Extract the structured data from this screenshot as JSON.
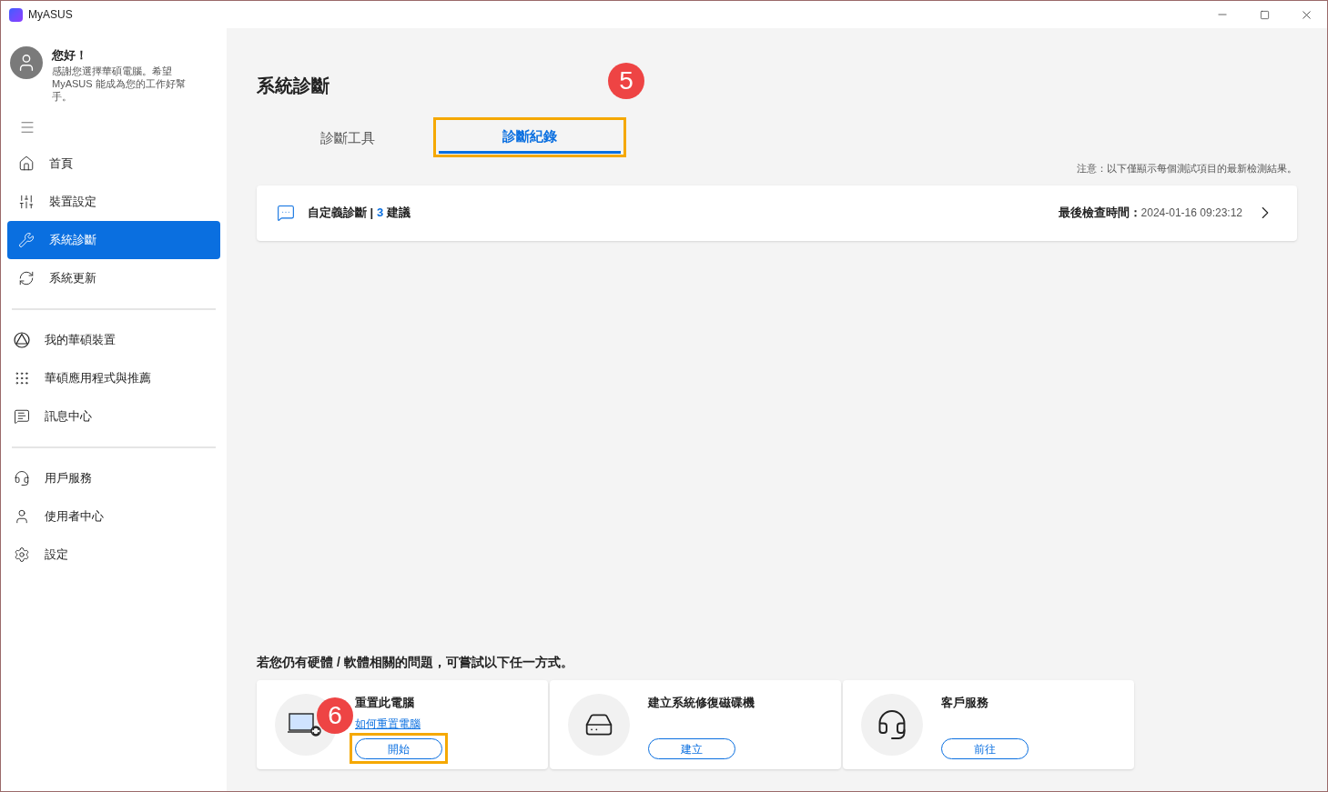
{
  "app": {
    "title": "MyASUS"
  },
  "profile": {
    "greeting": "您好！",
    "message": "感謝您選擇華碩電腦。希望 MyASUS 能成為您的工作好幫手。"
  },
  "sidebar": {
    "groups": [
      [
        {
          "label": "首頁",
          "selected": false
        },
        {
          "label": "裝置設定",
          "selected": false
        },
        {
          "label": "系統診斷",
          "selected": true
        },
        {
          "label": "系統更新",
          "selected": false
        }
      ],
      [
        {
          "label": "我的華碩裝置",
          "selected": false
        },
        {
          "label": "華碩應用程式與推薦",
          "selected": false
        },
        {
          "label": "訊息中心",
          "selected": false
        }
      ],
      [
        {
          "label": "用戶服務",
          "selected": false
        },
        {
          "label": "使用者中心",
          "selected": false
        },
        {
          "label": "設定",
          "selected": false
        }
      ]
    ]
  },
  "page": {
    "title": "系統診斷",
    "tabs": [
      {
        "label": "診斷工具",
        "selected": false
      },
      {
        "label": "診斷紀錄",
        "selected": true,
        "callout": "5"
      }
    ],
    "note": "注意：以下僅顯示每個測試項目的最新檢測結果。",
    "record": {
      "label": "自定義診斷 |",
      "count": "3",
      "suffix": "建議",
      "time_label": "最後檢查時間：",
      "time": "2024-01-16 09:23:12"
    }
  },
  "help": {
    "heading": "若您仍有硬體 / 軟體相關的問題，可嘗試以下任一方式。",
    "options": [
      {
        "title": "重置此電腦",
        "link": "如何重置電腦",
        "button": "開始",
        "callout": "6"
      },
      {
        "title": "建立系統修復磁碟機",
        "button": "建立"
      },
      {
        "title": "客戶服務",
        "button": "前往"
      }
    ]
  }
}
